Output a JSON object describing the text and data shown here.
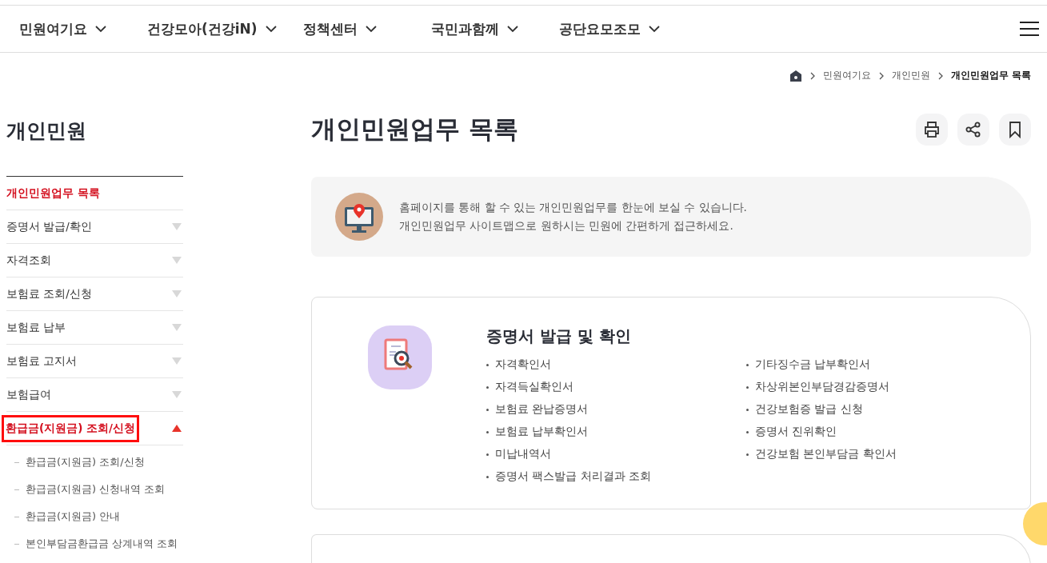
{
  "nav": {
    "items": [
      {
        "label": "민원여기요"
      },
      {
        "label": "건강모아(건강iN)"
      },
      {
        "label": "정책센터"
      },
      {
        "label": "국민과함께"
      },
      {
        "label": "공단요모조모"
      }
    ]
  },
  "breadcrumb": [
    "민원여기요",
    "개인민원",
    "개인민원업무 목록"
  ],
  "sidebar": {
    "title": "개인민원",
    "items": [
      {
        "label": "개인민원업무 목록",
        "kind": "link",
        "selected": true
      },
      {
        "label": "증명서 발급/확인",
        "kind": "group",
        "selected": false,
        "expanded": false
      },
      {
        "label": "자격조회",
        "kind": "group",
        "selected": false,
        "expanded": false
      },
      {
        "label": "보험료 조회/신청",
        "kind": "group",
        "selected": false,
        "expanded": false
      },
      {
        "label": "보험료 납부",
        "kind": "group",
        "selected": false,
        "expanded": false
      },
      {
        "label": "보험료 고지서",
        "kind": "group",
        "selected": false,
        "expanded": false
      },
      {
        "label": "보험급여",
        "kind": "group",
        "selected": false,
        "expanded": false
      },
      {
        "label": "환급금(지원금) 조회/신청",
        "kind": "group",
        "selected": true,
        "expanded": true,
        "highlighted": true,
        "children": [
          {
            "label": "환급금(지원금) 조회/신청"
          },
          {
            "label": "환급금(지원금) 신청내역 조회"
          },
          {
            "label": "환급금(지원금) 안내"
          },
          {
            "label": "본인부담금환급금 상계내역 조회"
          }
        ]
      }
    ]
  },
  "page": {
    "title": "개인민원업무 목록",
    "info": [
      "홈페이지를 통해 할 수 있는 개인민원업무를 한눈에 보실 수 있습니다.",
      "개인민원업무 사이트맵으로 원하시는 민원에 간편하게 접근하세요."
    ]
  },
  "sections": [
    {
      "title": "증명서 발급 및 확인",
      "columns": [
        [
          "자격확인서",
          "자격득실확인서",
          "보험료 완납증명서",
          "보험료 납부확인서",
          "미납내역서",
          "증명서 팩스발급 처리결과 조회"
        ],
        [
          "기타징수금 납부확인서",
          "차상위본인부담경감증명서",
          "건강보험증 발급 신청",
          "증명서 진위확인",
          "건강보험 본인부담금 확인서"
        ]
      ]
    }
  ]
}
